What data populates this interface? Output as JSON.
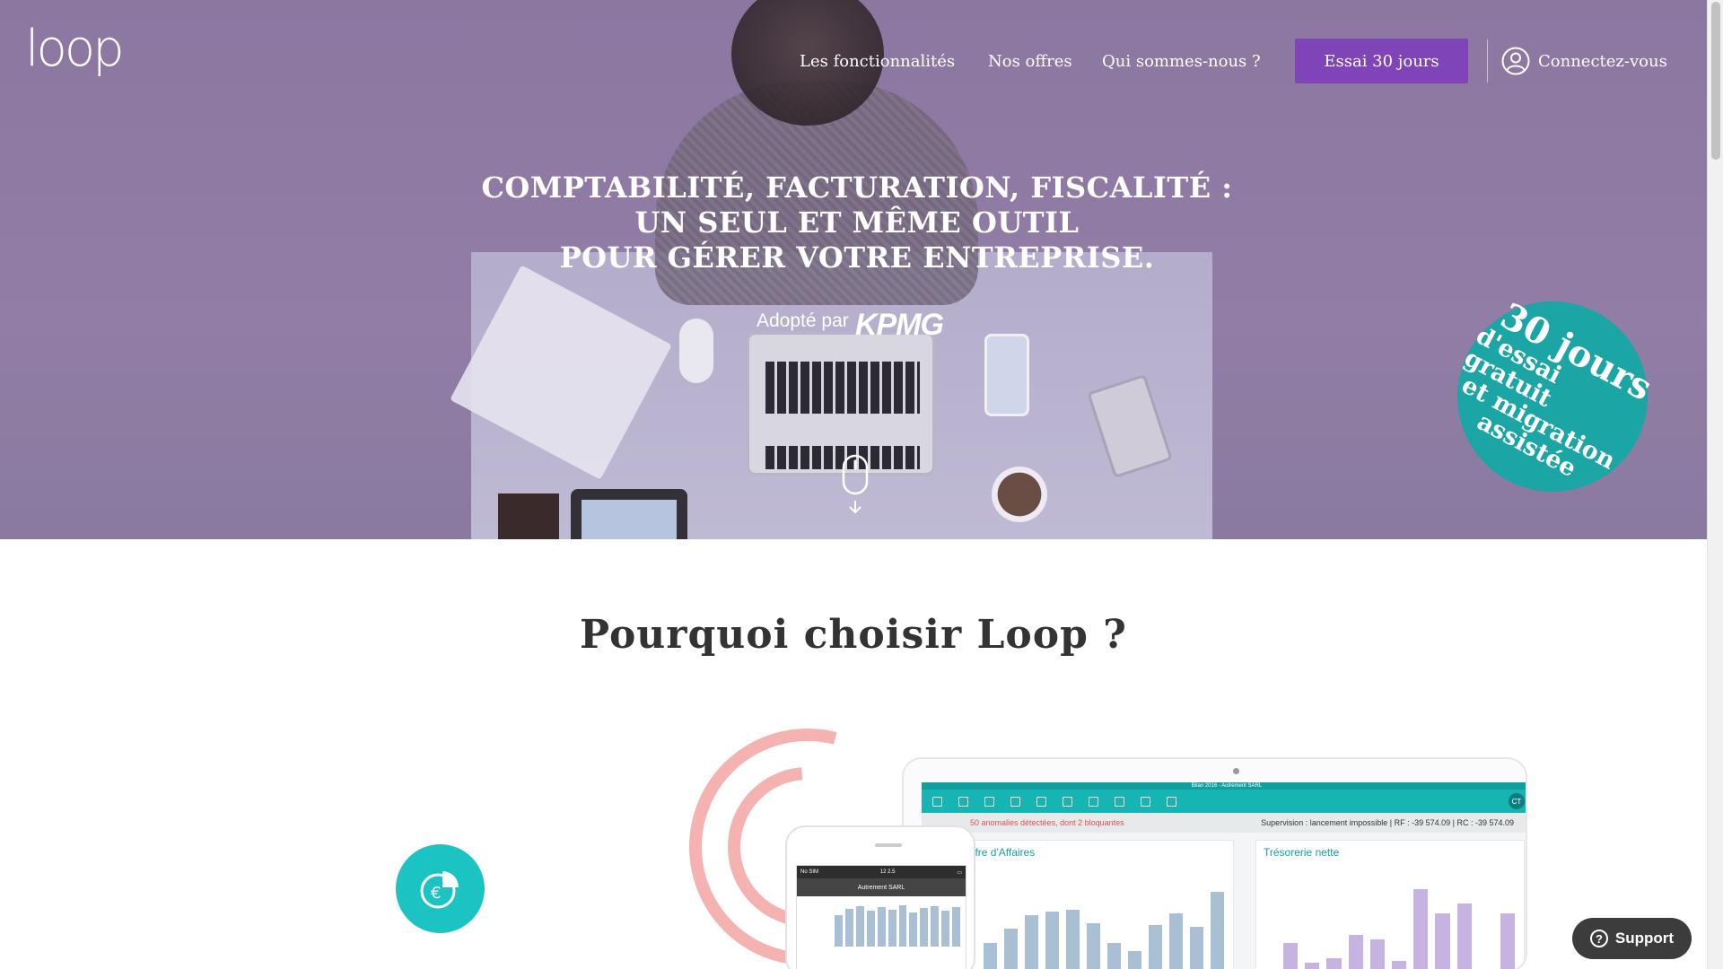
{
  "header": {
    "logo_text": "loop",
    "nav": [
      "Les fonctionnalités",
      "Nos offres",
      "Qui sommes-nous ?"
    ],
    "trial_button": "Essai 30 jours",
    "connect_label": "Connectez-vous"
  },
  "hero": {
    "title_lines": [
      "COMPTABILITÉ, FACTURATION, FISCALITÉ :",
      "UN SEUL ET MÊME OUTIL",
      "POUR GÉRER VOTRE ENTREPRISE."
    ],
    "adopted_label": "Adopté par",
    "adopted_brand": "KPMG",
    "badge": {
      "line1": "30 jours",
      "line2": "d'essai gratuit",
      "line3": "et migration",
      "line4": "assistée"
    },
    "colors": {
      "overlay": "#8c77a1",
      "trial_button": "#7e44b8",
      "badge": "#1ba5a5"
    }
  },
  "section": {
    "title": "Pourquoi choisir Loop ?",
    "app_window_title": "Bilan 2016 - Autrement SARL",
    "alert_text": "50 anomalies détectées, dont 2 bloquantes",
    "supervision_text": "Supervision : lancement impossible  |  RF : -39 574.09  |  RC : -39 574.09",
    "avatar": "CT",
    "panel1_title": "hiffre d'Affaires",
    "panel2_title": "Trésorerie nette",
    "phone": {
      "carrier": "No SIM",
      "time": "12 2.5",
      "title": "Autrement SARL"
    }
  },
  "support": {
    "label": "Support"
  }
}
